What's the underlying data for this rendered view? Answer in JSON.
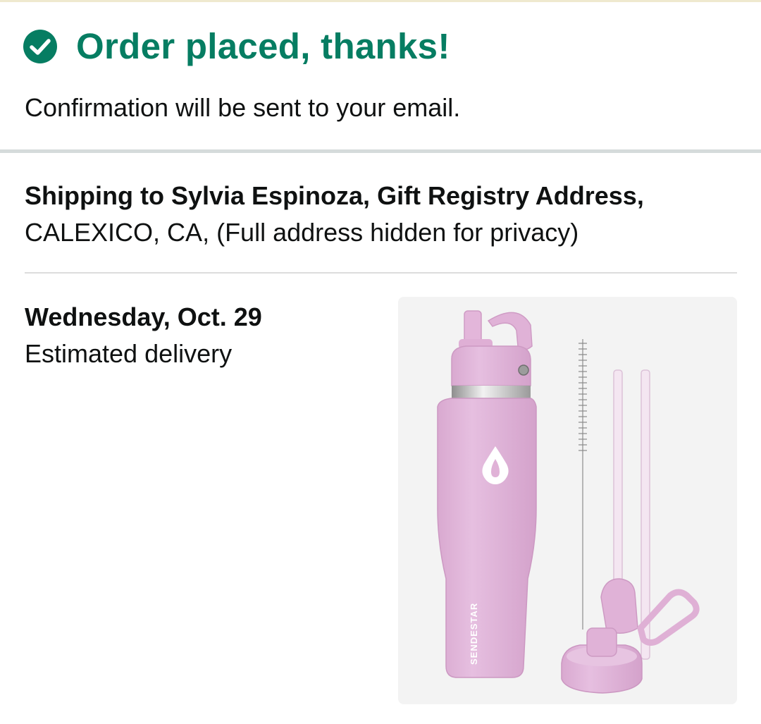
{
  "confirmation": {
    "title": "Order placed, thanks!",
    "subtitle": "Confirmation will be sent to your email.",
    "accent_color": "#067d62",
    "icon": "check-circle-icon"
  },
  "shipping": {
    "line1": "Shipping to Sylvia Espinoza, Gift Registry Address,",
    "line2": "CALEXICO, CA, (Full address hidden for privacy)"
  },
  "delivery": {
    "date": "Wednesday, Oct. 29",
    "label": "Estimated delivery"
  },
  "product": {
    "image": "pink-water-bottle-with-straws",
    "brand": "SENDESTAR"
  }
}
